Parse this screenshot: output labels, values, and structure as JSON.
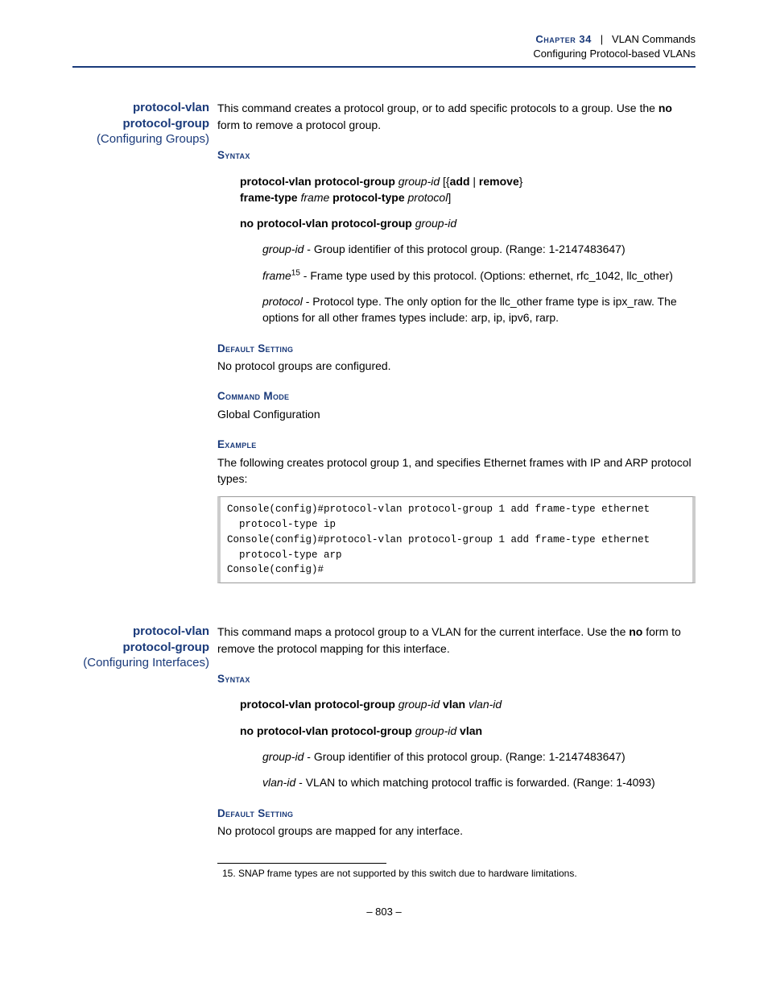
{
  "header": {
    "chapter_label": "Chapter 34",
    "chapter_title": "VLAN Commands",
    "subtitle": "Configuring Protocol-based VLANs"
  },
  "entries": [
    {
      "label_cmd1": "protocol-vlan",
      "label_cmd2": "protocol-group",
      "label_paren": "(Configuring Groups)",
      "intro_pre": "This command creates a protocol group, or to add specific protocols to a group. Use the ",
      "intro_bold": "no",
      "intro_post": " form to remove a protocol group.",
      "syntax_head": "Syntax",
      "syntax_line1_a": "protocol-vlan protocol-group",
      "syntax_line1_b": "group-id",
      "syntax_line1_c": " [{",
      "syntax_line1_d": "add",
      "syntax_line1_e": " | ",
      "syntax_line1_f": "remove",
      "syntax_line1_g": "} ",
      "syntax_line1_h": "frame-type",
      "syntax_line1_i": "frame",
      "syntax_line1_j": "protocol-type",
      "syntax_line1_k": "protocol",
      "syntax_line1_l": "]",
      "syntax_line2_a": "no protocol-vlan protocol-group",
      "syntax_line2_b": "group-id",
      "param1_name": "group-id",
      "param1_desc": " - Group identifier of this protocol group. (Range: 1-2147483647)",
      "param2_name": "frame",
      "param2_sup": "15",
      "param2_desc": " - Frame type used by this protocol. (Options: ethernet, rfc_1042, llc_other)",
      "param3_name": "protocol",
      "param3_desc": " - Protocol type. The only option for the llc_other frame type is ipx_raw. The options for all other frames types include: arp, ip, ipv6, rarp.",
      "default_head": "Default Setting",
      "default_text": "No protocol groups are configured.",
      "mode_head": "Command Mode",
      "mode_text": "Global Configuration",
      "example_head": "Example",
      "example_text": "The following creates protocol group 1, and specifies Ethernet frames with IP and ARP protocol types:",
      "code": "Console(config)#protocol-vlan protocol-group 1 add frame-type ethernet\n  protocol-type ip\nConsole(config)#protocol-vlan protocol-group 1 add frame-type ethernet\n  protocol-type arp\nConsole(config)#"
    },
    {
      "label_cmd1": "protocol-vlan",
      "label_cmd2": "protocol-group",
      "label_paren": "(Configuring Interfaces)",
      "intro_pre": "This command maps a protocol group to a VLAN for the current interface. Use the ",
      "intro_bold": "no",
      "intro_post": " form to remove the protocol mapping for this interface.",
      "syntax_head": "Syntax",
      "syntax_line1_a": "protocol-vlan protocol-group",
      "syntax_line1_b": "group-id",
      "syntax_line1_c": "vlan",
      "syntax_line1_d": "vlan-id",
      "syntax_line2_a": "no protocol-vlan protocol-group",
      "syntax_line2_b": "group-id",
      "syntax_line2_c": "vlan",
      "param1_name": "group-id",
      "param1_desc": " - Group identifier of this protocol group. (Range: 1-2147483647)",
      "param2_name": "vlan-id",
      "param2_desc": " - VLAN to which matching protocol traffic is forwarded. (Range: 1-4093)",
      "default_head": "Default Setting",
      "default_text": "No protocol groups are mapped for any interface."
    }
  ],
  "footnote": "15. SNAP frame types are not supported by this switch due to hardware limitations.",
  "pagenum": "–  803  –"
}
